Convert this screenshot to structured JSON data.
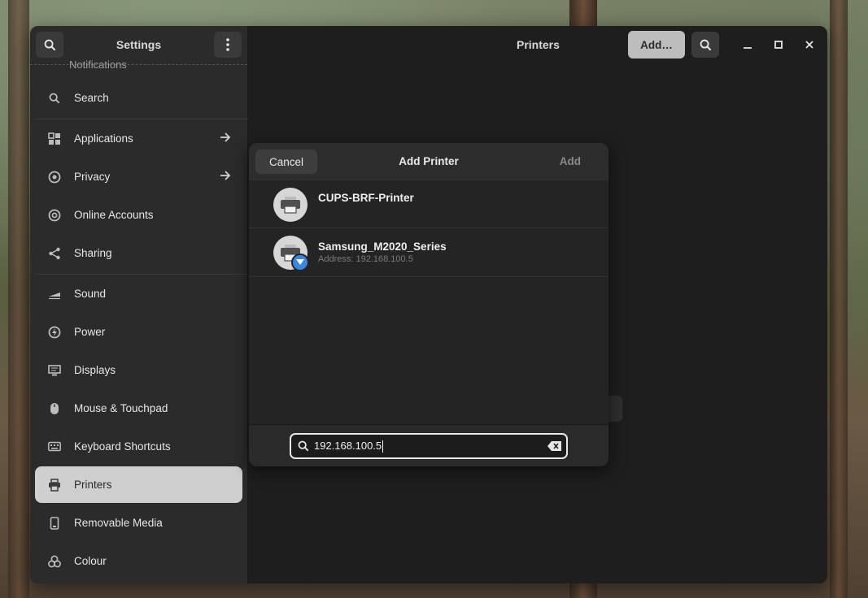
{
  "sidebar": {
    "title": "Settings",
    "cut_item": "Notifications",
    "items": [
      {
        "label": "Search",
        "icon": "search-icon"
      },
      {
        "label": "Applications",
        "icon": "apps-icon"
      },
      {
        "label": "Privacy",
        "icon": "privacy-icon"
      },
      {
        "label": "Online Accounts",
        "icon": "at-icon"
      },
      {
        "label": "Sharing",
        "icon": "share-icon"
      },
      {
        "label": "Sound",
        "icon": "sound-icon"
      },
      {
        "label": "Power",
        "icon": "power-icon"
      },
      {
        "label": "Displays",
        "icon": "display-icon"
      },
      {
        "label": "Mouse & Touchpad",
        "icon": "mouse-icon"
      },
      {
        "label": "Keyboard Shortcuts",
        "icon": "keyboard-icon"
      },
      {
        "label": "Printers",
        "icon": "printer-icon"
      },
      {
        "label": "Removable Media",
        "icon": "removable-media-icon"
      },
      {
        "label": "Colour",
        "icon": "colour-icon"
      }
    ]
  },
  "content": {
    "title": "Printers",
    "add_label": "Add…"
  },
  "dialog": {
    "title": "Add Printer",
    "cancel_label": "Cancel",
    "add_label": "Add",
    "printers": [
      {
        "name": "CUPS-BRF-Printer",
        "address": ""
      },
      {
        "name": "Samsung_M2020_Series",
        "address": "Address: 192.168.100.5"
      }
    ],
    "search_value": "192.168.100.5"
  },
  "colors": {
    "active_item": "#cfcfcf",
    "accent_badge": "#3a86e0"
  }
}
